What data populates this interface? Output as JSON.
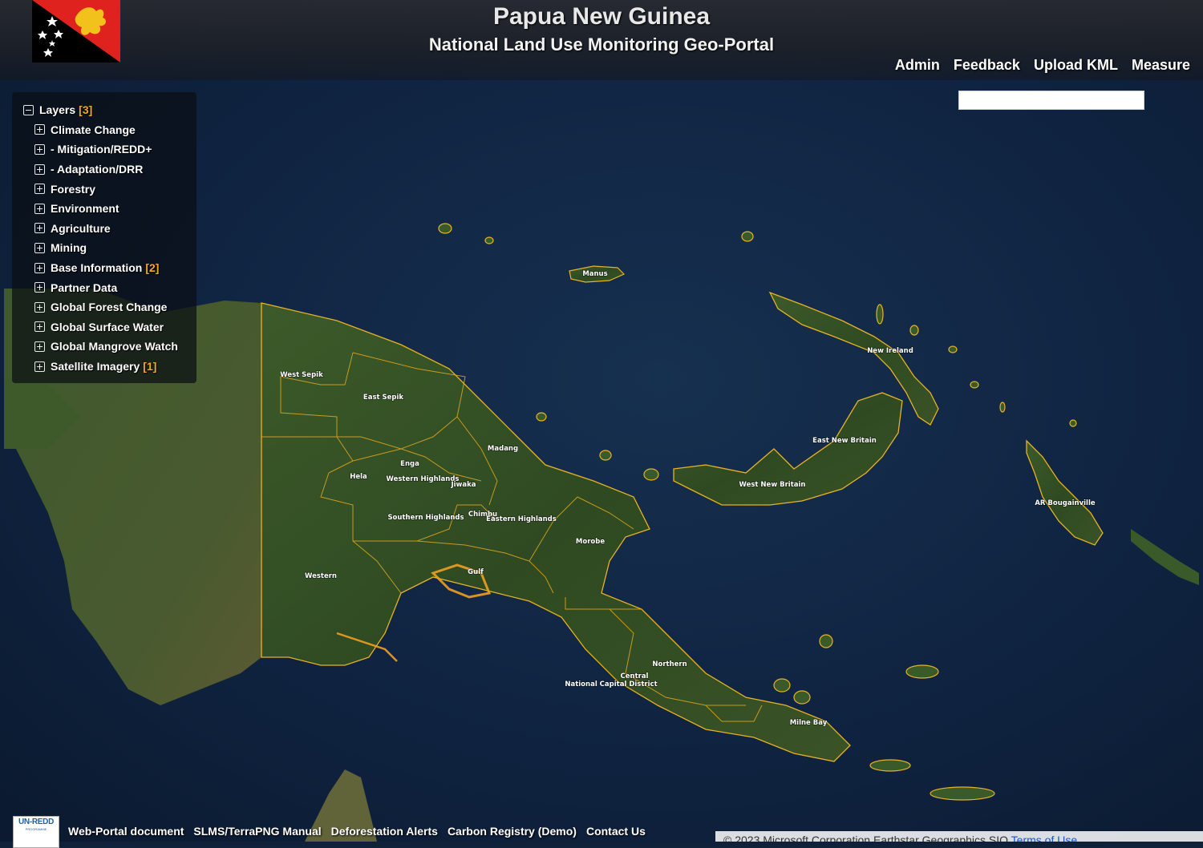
{
  "header": {
    "title": "Papua New Guinea",
    "subtitle": "National Land Use Monitoring Geo-Portal"
  },
  "top_nav": [
    "Admin",
    "Feedback",
    "Upload KML",
    "Measure"
  ],
  "search": {
    "value": ""
  },
  "layers": {
    "title": "Layers",
    "count": "[3]",
    "items": [
      {
        "label": "Climate Change",
        "count": ""
      },
      {
        "label": "- Mitigation/REDD+",
        "count": ""
      },
      {
        "label": "- Adaptation/DRR",
        "count": ""
      },
      {
        "label": "Forestry",
        "count": ""
      },
      {
        "label": "Environment",
        "count": ""
      },
      {
        "label": "Agriculture",
        "count": ""
      },
      {
        "label": "Mining",
        "count": ""
      },
      {
        "label": "Base Information",
        "count": "[2]"
      },
      {
        "label": "Partner Data",
        "count": ""
      },
      {
        "label": "Global Forest Change",
        "count": ""
      },
      {
        "label": "Global Surface Water",
        "count": ""
      },
      {
        "label": "Global Mangrove Watch",
        "count": ""
      },
      {
        "label": "Satellite Imagery",
        "count": "[1]"
      }
    ]
  },
  "map_labels": [
    "West Sepik",
    "East Sepik",
    "Madang",
    "Enga",
    "Western Highlands",
    "Jiwaka",
    "Hela",
    "Southern Highlands",
    "Chimbu",
    "Eastern Highlands",
    "Morobe",
    "Western",
    "Gulf",
    "Northern",
    "Central",
    "National Capital District",
    "Milne Bay",
    "Manus",
    "New Ireland",
    "East New Britain",
    "West New Britain",
    "AR Bougainville"
  ],
  "footer": {
    "logo_text": "UN-REDD",
    "logo_subtext": "PROGRAMME",
    "links": [
      "Web-Portal document",
      "SLMS/TerraPNG Manual",
      "Deforestation Alerts",
      "Carbon Registry (Demo)",
      "Contact Us"
    ]
  },
  "attribution": {
    "text": "© 2023 Microsoft Corporation Earthstar Geographics SIO",
    "link": "Terms of Use"
  },
  "colors": {
    "ocean": "#10213a",
    "boundary": "#e8b323",
    "accent": "#f5a623",
    "flag_red": "#e0221f",
    "flag_black": "#000000"
  }
}
